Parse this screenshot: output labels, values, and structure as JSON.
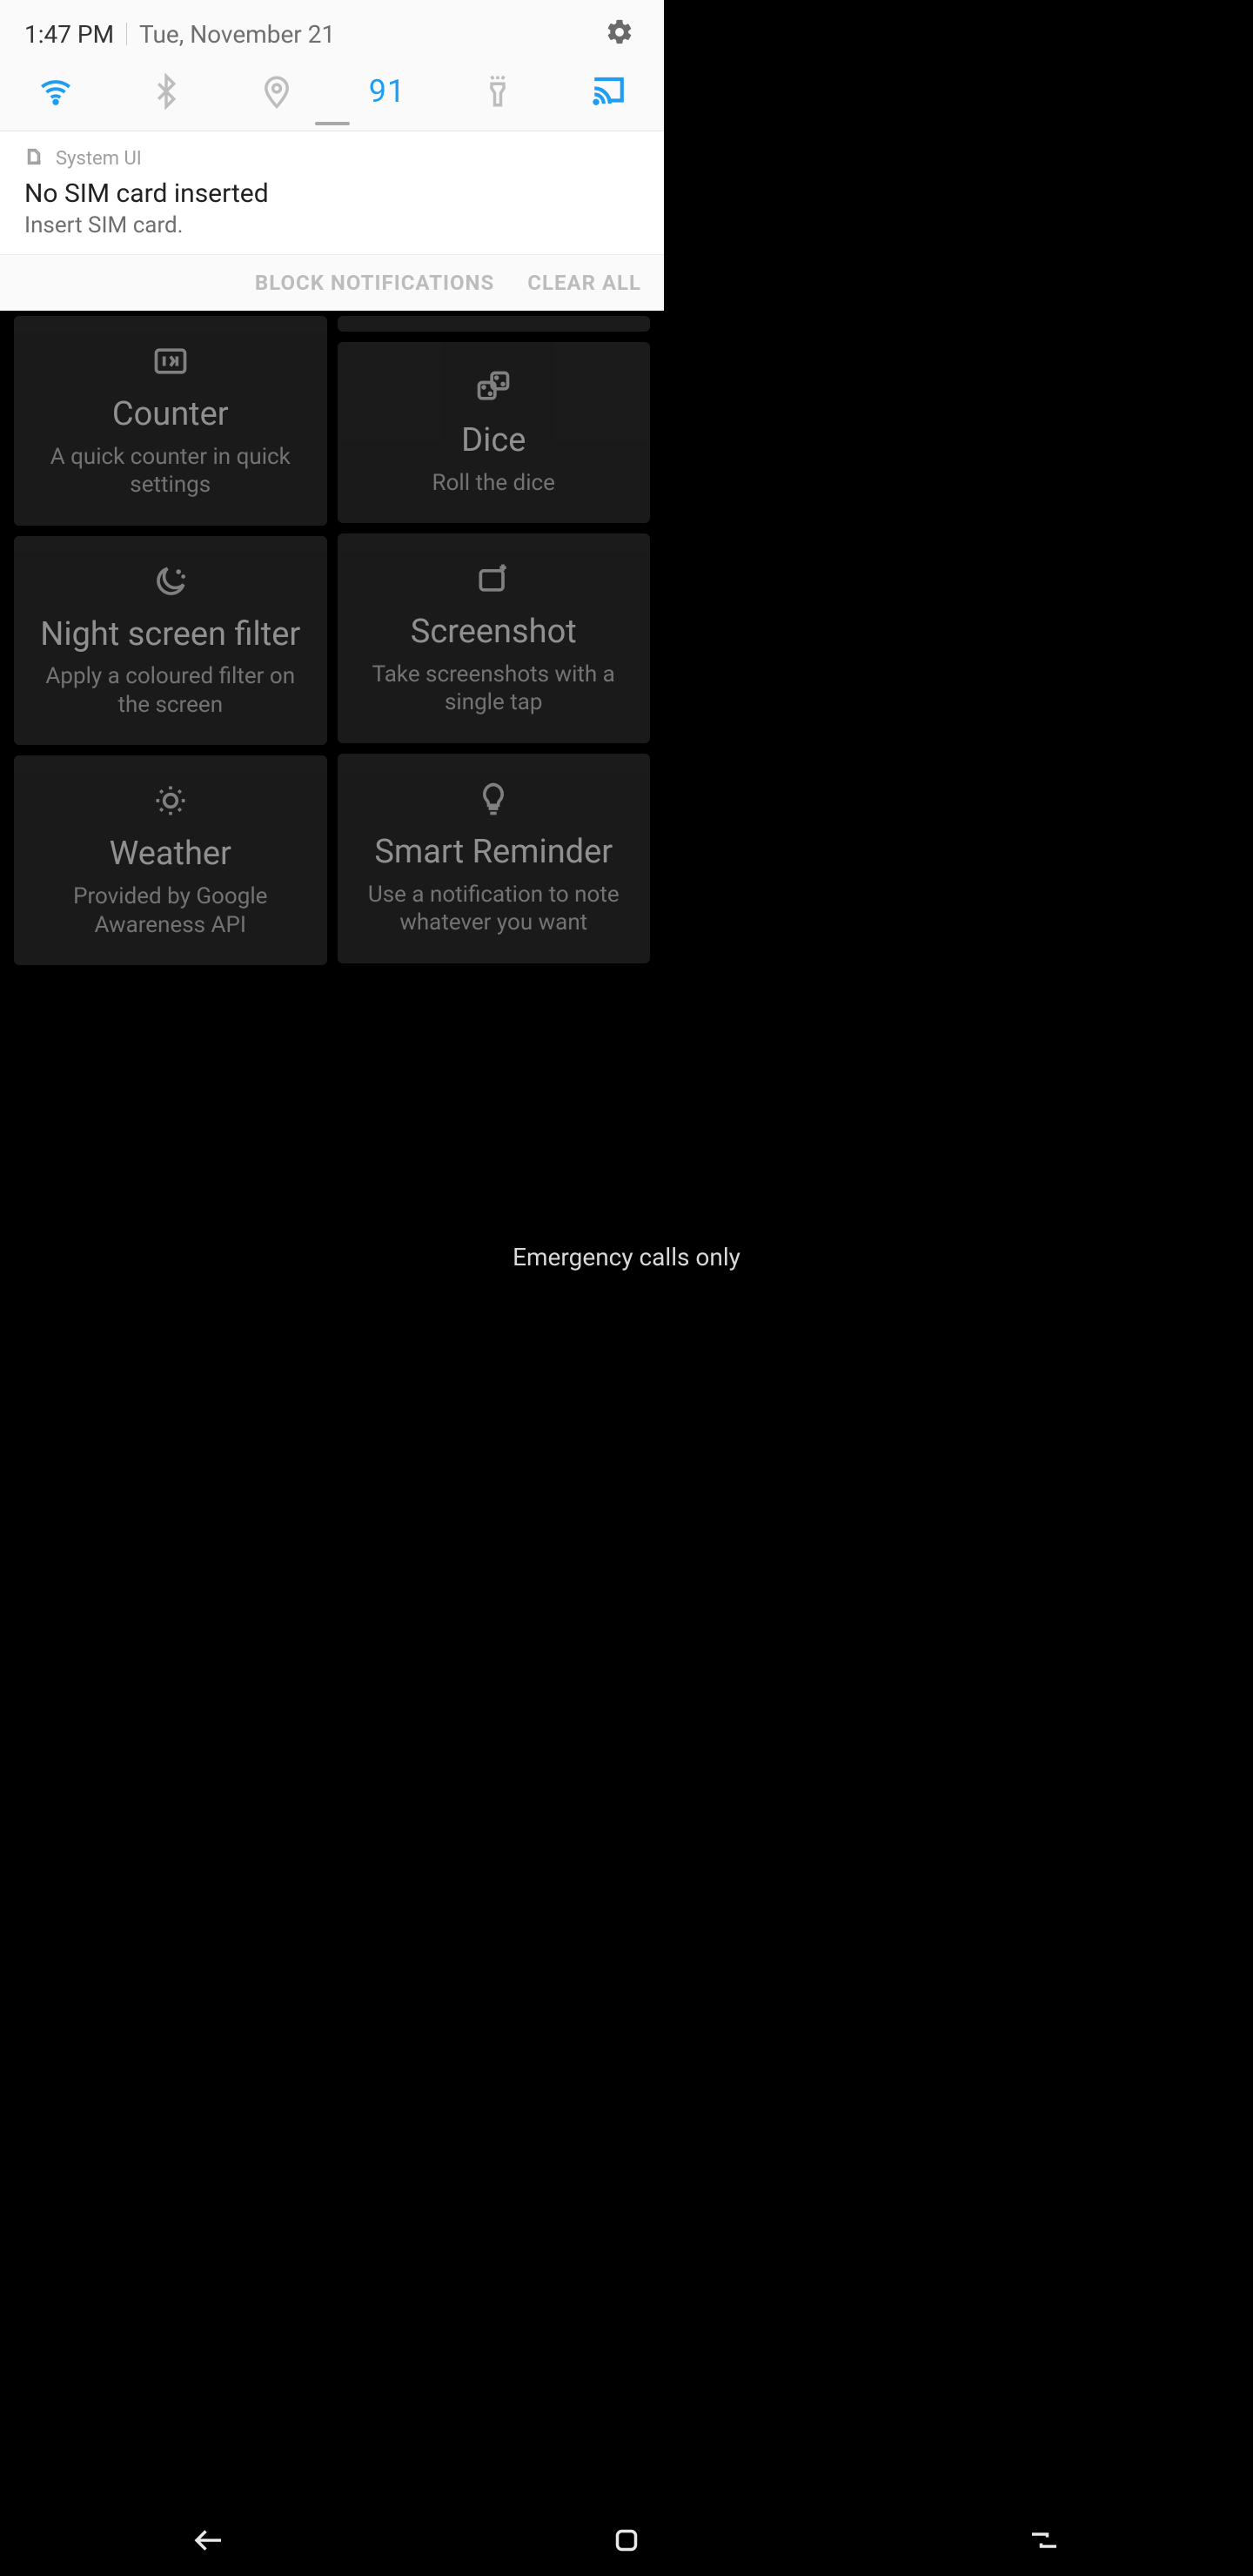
{
  "status": {
    "time": "1:47 PM",
    "date": "Tue, November 21",
    "brightness_value": "91"
  },
  "notification": {
    "app": "System UI",
    "title": "No SIM card inserted",
    "subtitle": "Insert SIM card."
  },
  "notification_actions": {
    "block": "BLOCK NOTIFICATIONS",
    "clear": "CLEAR ALL"
  },
  "cards": {
    "counter": {
      "title": "Counter",
      "sub": "A quick counter in quick settings"
    },
    "dice": {
      "title": "Dice",
      "sub": "Roll the dice"
    },
    "night": {
      "title": "Night screen filter",
      "sub": "Apply a coloured filter on the screen"
    },
    "screenshot": {
      "title": "Screenshot",
      "sub": "Take screenshots with a single tap"
    },
    "weather": {
      "title": "Weather",
      "sub": "Provided by Google Awareness API"
    },
    "reminder": {
      "title": "Smart Reminder",
      "sub": "Use a notification to note whatever you want"
    }
  },
  "footer": {
    "emergency": "Emergency calls only"
  }
}
